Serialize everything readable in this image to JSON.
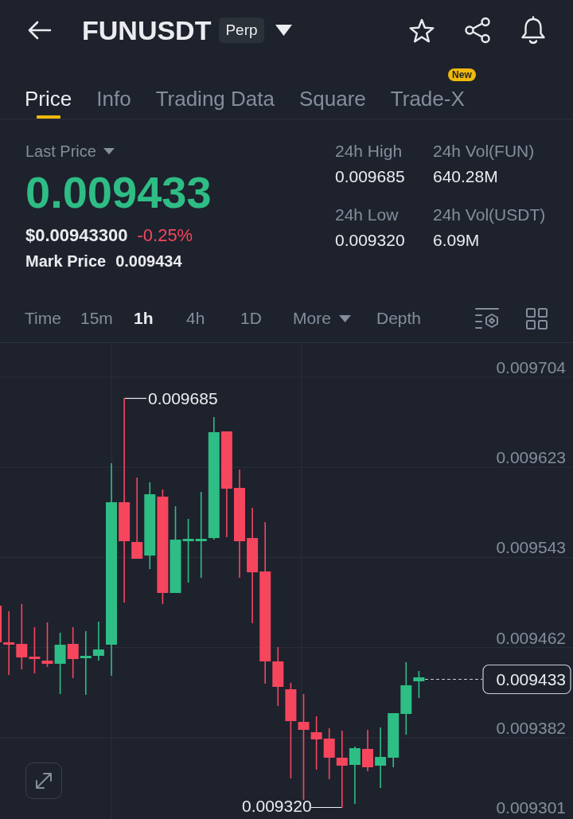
{
  "header": {
    "symbol": "FUNUSDT",
    "contract_type": "Perp"
  },
  "tabs": [
    {
      "label": "Price",
      "selected": true
    },
    {
      "label": "Info",
      "selected": false
    },
    {
      "label": "Trading Data",
      "selected": false
    },
    {
      "label": "Square",
      "selected": false
    },
    {
      "label": "Trade-X",
      "selected": false,
      "badge": "New"
    }
  ],
  "price_panel": {
    "price_type": "Last Price",
    "last_price": "0.009433",
    "last_price_rising": true,
    "usd_price": "$0.00943300",
    "change": "-0.25%",
    "change_positive": false,
    "mark_price_label": "Mark Price",
    "mark_price": "0.009434"
  },
  "stats": [
    {
      "label": "24h High",
      "value": "0.009685"
    },
    {
      "label": "24h Vol(FUN)",
      "value": "640.28M"
    },
    {
      "label": "24h Low",
      "value": "0.009320"
    },
    {
      "label": "24h Vol(USDT)",
      "value": "6.09M"
    }
  ],
  "intervals": [
    {
      "label": "Time",
      "kind": "option",
      "selected": false
    },
    {
      "label": "15m",
      "kind": "option",
      "selected": false
    },
    {
      "label": "1h",
      "kind": "option",
      "selected": true
    },
    {
      "label": "4h",
      "kind": "option",
      "selected": false
    },
    {
      "label": "1D",
      "kind": "option",
      "selected": false
    },
    {
      "label": "More",
      "kind": "dropdown",
      "selected": false
    },
    {
      "label": "Depth",
      "kind": "option",
      "selected": false
    }
  ],
  "chart": {
    "price_axis": [
      "0.009704",
      "0.009623",
      "0.009543",
      "0.009462",
      "0.009382",
      "0.009301"
    ],
    "high_label": "0.009685",
    "low_label": "0.009320",
    "current_price": "0.009433"
  }
}
